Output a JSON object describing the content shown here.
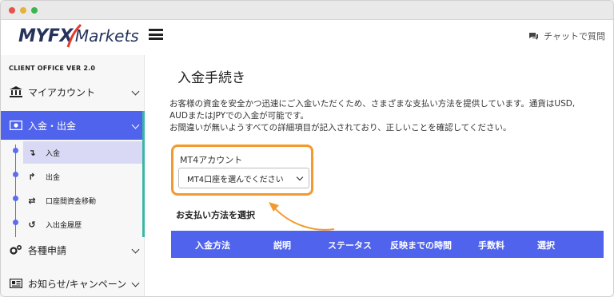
{
  "header": {
    "logo_myfx": "MYFX",
    "logo_markets": "Markets",
    "chat_label": "チャットで質問",
    "brand_colors": {
      "navy": "#25335c",
      "accent": "#4f63ec",
      "orange": "#f39a2e",
      "teal": "#3bb6a6"
    }
  },
  "sidebar": {
    "version": "CLIENT OFFICE VER 2.0",
    "items": [
      {
        "label": "マイアカウント",
        "icon": "bank-icon"
      },
      {
        "label": "入金・出金",
        "icon": "money-icon"
      },
      {
        "label": "各種申請",
        "icon": "gears-icon"
      },
      {
        "label": "お知らせ/キャンペーン",
        "icon": "news-icon"
      }
    ],
    "subitems": [
      {
        "label": "入金",
        "icon": "deposit-arrow-icon"
      },
      {
        "label": "出金",
        "icon": "withdraw-arrow-icon"
      },
      {
        "label": "口座間資金移動",
        "icon": "transfer-icon"
      },
      {
        "label": "入出金履歴",
        "icon": "history-icon"
      }
    ]
  },
  "main": {
    "title": "入金手続き",
    "intro_line1": "お客様の資金を安全かつ迅速にご入金いただくため、さまざまな支払い方法を提供しています。通貨はUSD,",
    "intro_line2": "AUDまたはJPYでの入金が可能です。",
    "intro_line3": "お間違いが無いようすべての詳細項目が記入されており、正しいことを確認してください。",
    "account_label": "MT4アカウント",
    "account_select": "MT4口座を選んでください",
    "method_title": "お支払い方法を選択",
    "columns": [
      "入金方法",
      "説明",
      "ステータス",
      "反映までの時間",
      "手数料",
      "選択"
    ]
  }
}
